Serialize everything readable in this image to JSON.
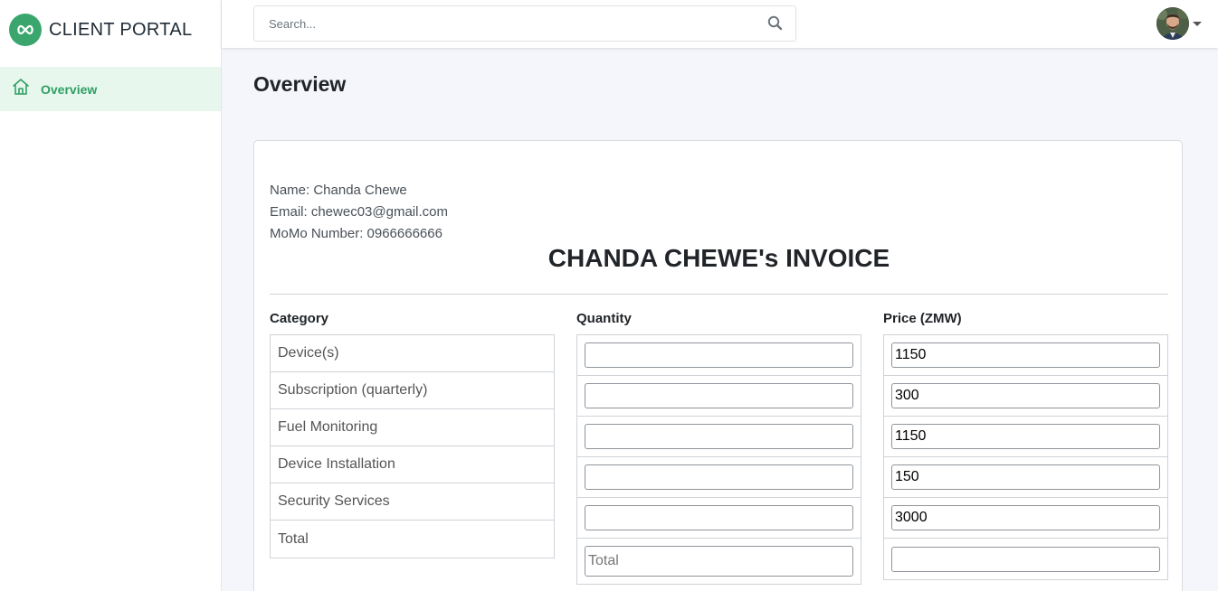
{
  "brand": {
    "name": "CLIENT PORTAL"
  },
  "sidebar": {
    "items": [
      {
        "label": "Overview",
        "icon": "home-icon"
      }
    ]
  },
  "header": {
    "search_placeholder": "Search..."
  },
  "main": {
    "title": "Overview"
  },
  "client": {
    "name_line": "Name: Chanda Chewe",
    "email_line": "Email: chewec03@gmail.com",
    "momo_line": "MoMo Number: 0966666666"
  },
  "invoice": {
    "title": "CHANDA CHEWE's INVOICE",
    "headers": {
      "category": "Category",
      "quantity": "Quantity",
      "price": "Price (ZMW)"
    },
    "categories": [
      "Device(s)",
      "Subscription (quarterly)",
      "Fuel Monitoring",
      "Device Installation",
      "Security Services",
      "Total"
    ],
    "quantities": [
      "",
      "",
      "",
      "",
      ""
    ],
    "quantity_total_placeholder": "Total",
    "prices": [
      "1150",
      "300",
      "1150",
      "150",
      "3000",
      ""
    ]
  },
  "colors": {
    "accent": "#3aa66e",
    "active_bg": "#e8f7ee",
    "active_text": "#2f9e62"
  }
}
